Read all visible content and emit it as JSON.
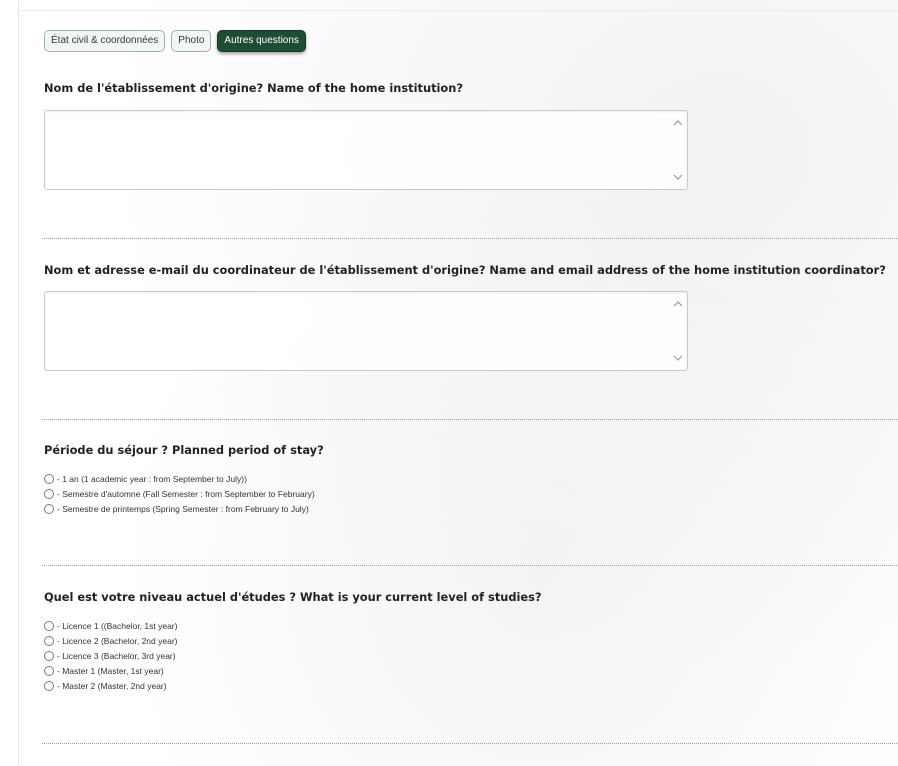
{
  "tabs": [
    {
      "label": "État civil & coordonnées",
      "active": false
    },
    {
      "label": "Photo",
      "active": false
    },
    {
      "label": "Autres questions",
      "active": true
    }
  ],
  "questions": {
    "home_institution": {
      "label": "Nom de l'établissement d'origine? Name of the home institution?",
      "value": ""
    },
    "coordinator": {
      "label": "Nom et adresse e-mail du coordinateur de l'établissement d'origine? Name and email address of the home institution coordinator?",
      "value": ""
    },
    "period": {
      "label": "Période du séjour ? Planned period of stay?",
      "options": [
        "- 1 an (1 academic year : from September to July))",
        "- Semestre d'automne (Fall Semester : from September to February)",
        "- Semestre de printemps (Spring Semester : from February to July)"
      ]
    },
    "level": {
      "label": "Quel est votre niveau actuel d'études ? What is your current level of studies?",
      "options": [
        "- Licence 1 ((Bachelor, 1st year)",
        "- Licence 2 (Bachelor, 2nd year)",
        "- Licence 3 (Bachelor, 3rd year)",
        "- Master 1 (Master, 1st year)",
        "- Master 2 (Master, 2nd year)"
      ]
    }
  },
  "colors": {
    "tab_active_bg": "#1e4d35",
    "tab_border": "#9fb5a4"
  }
}
